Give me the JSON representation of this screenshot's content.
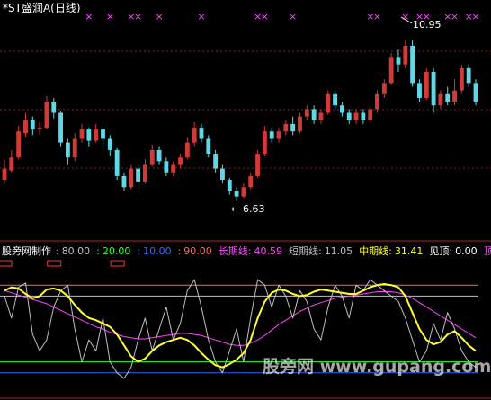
{
  "chart_data": [
    {
      "type": "candlestick",
      "title": "*ST盛润A(日线)",
      "price_labels": {
        "high": "10.95",
        "low": "6.63"
      },
      "ylim": [
        5.8,
        11.5
      ],
      "colors": {
        "up": "#d23a3a",
        "down": "#5fd8e6",
        "marker": "#ff44ff",
        "title": "#ffffff"
      },
      "markers": {
        "symbol": "×",
        "bars": [
          12,
          15,
          18,
          19,
          22,
          28,
          36,
          37,
          41,
          52,
          53,
          57,
          59,
          60,
          63,
          64,
          66,
          67
        ]
      },
      "candles": [
        {
          "o": 7.2,
          "c": 7.5,
          "h": 7.75,
          "l": 7.1
        },
        {
          "o": 7.45,
          "c": 7.8,
          "h": 8.0,
          "l": 7.4
        },
        {
          "o": 7.8,
          "c": 8.5,
          "h": 8.65,
          "l": 7.75
        },
        {
          "o": 8.45,
          "c": 8.8,
          "h": 9.0,
          "l": 8.35
        },
        {
          "o": 8.8,
          "c": 8.55,
          "h": 8.9,
          "l": 8.4
        },
        {
          "o": 8.55,
          "c": 8.6,
          "h": 8.75,
          "l": 8.4
        },
        {
          "o": 8.6,
          "c": 9.3,
          "h": 9.45,
          "l": 8.55
        },
        {
          "o": 9.3,
          "c": 9.0,
          "h": 9.4,
          "l": 8.85
        },
        {
          "o": 9.0,
          "c": 8.2,
          "h": 9.05,
          "l": 8.1
        },
        {
          "o": 8.2,
          "c": 7.8,
          "h": 8.3,
          "l": 7.6
        },
        {
          "o": 7.8,
          "c": 8.3,
          "h": 8.45,
          "l": 7.7
        },
        {
          "o": 8.3,
          "c": 8.55,
          "h": 8.7,
          "l": 8.2
        },
        {
          "o": 8.55,
          "c": 8.25,
          "h": 8.6,
          "l": 8.1
        },
        {
          "o": 8.25,
          "c": 8.55,
          "h": 8.7,
          "l": 8.2
        },
        {
          "o": 8.55,
          "c": 8.3,
          "h": 8.6,
          "l": 8.1
        },
        {
          "o": 8.3,
          "c": 8.0,
          "h": 8.4,
          "l": 7.85
        },
        {
          "o": 8.0,
          "c": 7.3,
          "h": 8.05,
          "l": 7.2
        },
        {
          "o": 7.3,
          "c": 7.0,
          "h": 7.4,
          "l": 6.9
        },
        {
          "o": 7.0,
          "c": 7.5,
          "h": 7.6,
          "l": 6.95
        },
        {
          "o": 7.5,
          "c": 7.15,
          "h": 7.6,
          "l": 6.95
        },
        {
          "o": 7.15,
          "c": 7.6,
          "h": 7.75,
          "l": 7.1
        },
        {
          "o": 7.6,
          "c": 8.0,
          "h": 8.15,
          "l": 7.55
        },
        {
          "o": 8.0,
          "c": 7.7,
          "h": 8.1,
          "l": 7.6
        },
        {
          "o": 7.7,
          "c": 7.4,
          "h": 7.8,
          "l": 7.3
        },
        {
          "o": 7.4,
          "c": 7.6,
          "h": 7.7,
          "l": 7.3
        },
        {
          "o": 7.6,
          "c": 7.8,
          "h": 7.9,
          "l": 7.5
        },
        {
          "o": 7.8,
          "c": 8.2,
          "h": 8.35,
          "l": 7.75
        },
        {
          "o": 8.2,
          "c": 8.6,
          "h": 8.75,
          "l": 8.1
        },
        {
          "o": 8.6,
          "c": 8.3,
          "h": 8.7,
          "l": 8.2
        },
        {
          "o": 8.3,
          "c": 7.9,
          "h": 8.4,
          "l": 7.8
        },
        {
          "o": 7.9,
          "c": 7.5,
          "h": 8.0,
          "l": 7.4
        },
        {
          "o": 7.5,
          "c": 7.2,
          "h": 7.6,
          "l": 7.1
        },
        {
          "o": 7.2,
          "c": 6.9,
          "h": 7.25,
          "l": 6.8
        },
        {
          "o": 6.9,
          "c": 6.75,
          "h": 7.0,
          "l": 6.63
        },
        {
          "o": 6.75,
          "c": 7.0,
          "h": 7.1,
          "l": 6.7
        },
        {
          "o": 7.0,
          "c": 7.3,
          "h": 7.4,
          "l": 6.95
        },
        {
          "o": 7.3,
          "c": 7.9,
          "h": 8.0,
          "l": 7.25
        },
        {
          "o": 7.9,
          "c": 8.5,
          "h": 8.65,
          "l": 7.85
        },
        {
          "o": 8.5,
          "c": 8.3,
          "h": 8.6,
          "l": 8.2
        },
        {
          "o": 8.3,
          "c": 8.5,
          "h": 8.6,
          "l": 8.2
        },
        {
          "o": 8.5,
          "c": 8.7,
          "h": 8.8,
          "l": 8.4
        },
        {
          "o": 8.7,
          "c": 8.5,
          "h": 8.9,
          "l": 8.4
        },
        {
          "o": 8.5,
          "c": 8.9,
          "h": 9.0,
          "l": 8.45
        },
        {
          "o": 8.9,
          "c": 9.1,
          "h": 9.2,
          "l": 8.8
        },
        {
          "o": 9.1,
          "c": 8.8,
          "h": 9.2,
          "l": 8.7
        },
        {
          "o": 8.8,
          "c": 9.0,
          "h": 9.1,
          "l": 8.7
        },
        {
          "o": 9.0,
          "c": 9.5,
          "h": 9.6,
          "l": 8.95
        },
        {
          "o": 9.5,
          "c": 9.2,
          "h": 9.6,
          "l": 9.1
        },
        {
          "o": 9.2,
          "c": 9.0,
          "h": 9.3,
          "l": 8.9
        },
        {
          "o": 9.0,
          "c": 8.8,
          "h": 9.1,
          "l": 8.7
        },
        {
          "o": 8.8,
          "c": 9.0,
          "h": 9.1,
          "l": 8.7
        },
        {
          "o": 9.0,
          "c": 8.8,
          "h": 9.1,
          "l": 8.7
        },
        {
          "o": 8.8,
          "c": 9.1,
          "h": 9.2,
          "l": 8.75
        },
        {
          "o": 9.1,
          "c": 9.5,
          "h": 9.6,
          "l": 9.0
        },
        {
          "o": 9.5,
          "c": 9.8,
          "h": 9.9,
          "l": 9.4
        },
        {
          "o": 9.8,
          "c": 10.5,
          "h": 10.6,
          "l": 9.75
        },
        {
          "o": 10.5,
          "c": 10.3,
          "h": 10.7,
          "l": 10.1
        },
        {
          "o": 10.3,
          "c": 10.8,
          "h": 10.95,
          "l": 10.2
        },
        {
          "o": 10.8,
          "c": 9.8,
          "h": 10.95,
          "l": 9.7
        },
        {
          "o": 9.8,
          "c": 9.4,
          "h": 9.9,
          "l": 9.3
        },
        {
          "o": 9.4,
          "c": 10.1,
          "h": 10.2,
          "l": 9.35
        },
        {
          "o": 10.1,
          "c": 9.2,
          "h": 10.2,
          "l": 9.0
        },
        {
          "o": 9.2,
          "c": 9.5,
          "h": 9.6,
          "l": 9.1
        },
        {
          "o": 9.5,
          "c": 9.3,
          "h": 9.7,
          "l": 9.2
        },
        {
          "o": 9.3,
          "c": 9.6,
          "h": 9.9,
          "l": 9.2
        },
        {
          "o": 9.6,
          "c": 10.2,
          "h": 10.3,
          "l": 9.5
        },
        {
          "o": 10.2,
          "c": 9.8,
          "h": 10.3,
          "l": 9.7
        },
        {
          "o": 9.8,
          "c": 9.3,
          "h": 9.9,
          "l": 9.2
        }
      ]
    },
    {
      "type": "line",
      "indicator_name": "股旁网制作",
      "levels_text": [
        {
          "text": "80.00",
          "color": "#c0c0c0"
        },
        {
          "text": "20.00",
          "color": "#33ff33"
        },
        {
          "text": "10.00",
          "color": "#3366ff"
        },
        {
          "text": "90.00",
          "color": "#ff6666"
        }
      ],
      "series_labels": [
        {
          "label": "长期线",
          "value": "40.59",
          "color": "#ff44ff"
        },
        {
          "label": "短期线",
          "value": "11.05",
          "color": "#c0c0c0"
        },
        {
          "label": "中期线",
          "value": "31.41",
          "color": "#ffff33"
        },
        {
          "label": "见顶",
          "value": "0.00",
          "color": "#ffffff"
        }
      ],
      "top_label": {
        "text": "顶部",
        "color": "#ff44ff"
      },
      "ylim": [
        0,
        100
      ],
      "hlines": [
        {
          "value": 90,
          "color": "#ff6666"
        },
        {
          "value": 80,
          "color": "#c0c0c0"
        },
        {
          "value": 20,
          "color": "#33ff33"
        },
        {
          "value": 10,
          "color": "#3366ff"
        }
      ],
      "top_boxes": {
        "bars": [
          0,
          7,
          16
        ],
        "color": "#ff3333"
      },
      "series": [
        {
          "color": "#ffff33",
          "width": 2,
          "values": [
            85,
            88,
            87,
            82,
            78,
            80,
            86,
            87,
            85,
            80,
            72,
            65,
            60,
            58,
            55,
            52,
            45,
            35,
            25,
            20,
            23,
            30,
            35,
            38,
            40,
            42,
            40,
            35,
            28,
            22,
            17,
            15,
            18,
            22,
            28,
            40,
            60,
            75,
            83,
            86,
            85,
            82,
            80,
            81,
            84,
            86,
            85,
            84,
            83,
            82,
            82,
            85,
            88,
            90,
            91,
            90,
            88,
            80,
            65,
            50,
            40,
            36,
            38,
            45,
            48,
            42,
            35,
            30
          ]
        },
        {
          "color": "#c0c0c0",
          "width": 1,
          "values": [
            80,
            60,
            88,
            92,
            45,
            30,
            40,
            70,
            85,
            90,
            50,
            20,
            40,
            30,
            60,
            20,
            10,
            5,
            15,
            40,
            60,
            30,
            50,
            70,
            40,
            55,
            85,
            95,
            70,
            40,
            20,
            10,
            30,
            50,
            20,
            60,
            95,
            90,
            70,
            90,
            80,
            60,
            85,
            75,
            50,
            40,
            70,
            90,
            80,
            60,
            90,
            85,
            95,
            90,
            85,
            80,
            75,
            60,
            40,
            20,
            30,
            55,
            40,
            65,
            50,
            30,
            20,
            15
          ]
        },
        {
          "color": "#ff44ff",
          "width": 1,
          "values": [
            85,
            83,
            81,
            79,
            77,
            75,
            73,
            70,
            67,
            64,
            61,
            58,
            55,
            52,
            50,
            47,
            45,
            43,
            42,
            41,
            41,
            42,
            43,
            44,
            45,
            46,
            46,
            45,
            44,
            42,
            40,
            38,
            36,
            35,
            35,
            37,
            40,
            44,
            49,
            54,
            58,
            62,
            66,
            69,
            72,
            74,
            76,
            78,
            79,
            80,
            81,
            82,
            83,
            84,
            84,
            84,
            83,
            81,
            78,
            74,
            70,
            66,
            62,
            58,
            54,
            50,
            46,
            42
          ]
        }
      ]
    }
  ],
  "watermark": "股旁网 www.gupang.com"
}
